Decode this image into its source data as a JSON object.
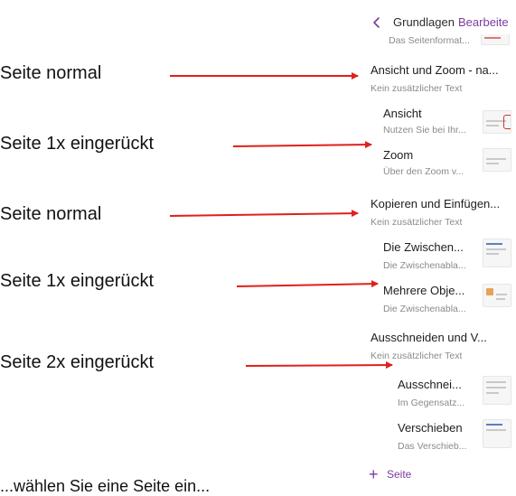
{
  "header": {
    "back_icon": "chevron-left-icon",
    "title": "Grundlagen",
    "edit_label": "Bearbeite"
  },
  "pages": [
    {
      "title": "",
      "subtitle": "Das Seitenformat..."
    },
    {
      "title": "Ansicht und Zoom - na...",
      "subtitle": "Kein zusätzlicher Text"
    },
    {
      "title": "Ansicht",
      "subtitle": "Nutzen Sie bei Ihr..."
    },
    {
      "title": "Zoom",
      "subtitle": "Über den Zoom v..."
    },
    {
      "title": "Kopieren und Einfügen...",
      "subtitle": "Kein zusätzlicher Text"
    },
    {
      "title": "Die Zwischen...",
      "subtitle": "Die Zwischenabla..."
    },
    {
      "title": "Mehrere Obje...",
      "subtitle": "Die Zwischenabla..."
    },
    {
      "title": "Ausschneiden und V...",
      "subtitle": "Kein zusätzlicher Text"
    },
    {
      "title": "Ausschnei...",
      "subtitle": "Im Gegensatz..."
    },
    {
      "title": "Verschieben",
      "subtitle": "Das Verschieb..."
    }
  ],
  "add_page": {
    "icon": "plus-icon",
    "label": "Seite"
  },
  "annotations": [
    {
      "label": "Seite normal"
    },
    {
      "label": "Seite 1x eingerückt"
    },
    {
      "label": "Seite normal"
    },
    {
      "label": "Seite 1x eingerückt"
    },
    {
      "label": "Seite 2x eingerückt"
    }
  ],
  "bottom_text": "...wählen Sie eine Seite ein...",
  "colors": {
    "accent": "#7a3d9e",
    "arrow": "#e0201b",
    "subtitle": "#8a8a8a"
  }
}
